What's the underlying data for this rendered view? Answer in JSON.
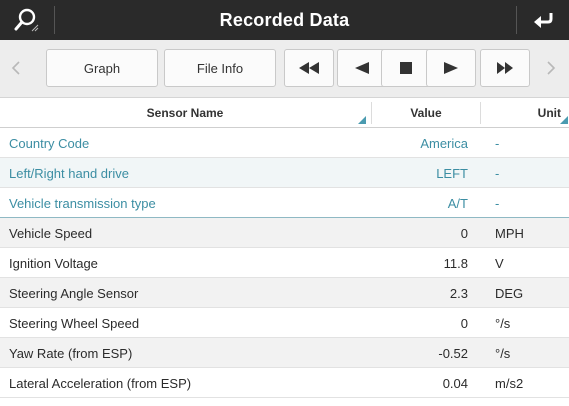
{
  "header": {
    "title": "Recorded Data"
  },
  "toolbar": {
    "graph_label": "Graph",
    "file_info_label": "File Info"
  },
  "table": {
    "columns": {
      "name": "Sensor Name",
      "value": "Value",
      "unit": "Unit"
    },
    "info_rows": [
      {
        "name": "Country Code",
        "value": "America",
        "unit": "-"
      },
      {
        "name": "Left/Right hand drive",
        "value": "LEFT",
        "unit": "-"
      },
      {
        "name": "Vehicle transmission type",
        "value": "A/T",
        "unit": "-"
      }
    ],
    "data_rows": [
      {
        "name": "Vehicle Speed",
        "value": "0",
        "unit": "MPH"
      },
      {
        "name": "Ignition Voltage",
        "value": "11.8",
        "unit": "V"
      },
      {
        "name": "Steering Angle Sensor",
        "value": "2.3",
        "unit": "DEG"
      },
      {
        "name": "Steering Wheel Speed",
        "value": "0",
        "unit": "°/s"
      },
      {
        "name": "Yaw Rate (from ESP)",
        "value": "-0.52",
        "unit": "°/s"
      },
      {
        "name": "Lateral Acceleration (from ESP)",
        "value": "0.04",
        "unit": "m/s2"
      }
    ]
  },
  "colors": {
    "titlebar_bg": "#2a2a2a",
    "info_text": "#3c8ea3",
    "accent": "#3c8ea3"
  },
  "icons": {
    "search": "search-icon",
    "back": "return-arrow-icon",
    "scroll_left": "chevron-left-icon",
    "scroll_right": "chevron-right-icon",
    "rewind": "rewind-icon",
    "step_back": "step-back-icon",
    "stop": "stop-icon",
    "play": "play-icon",
    "fast_forward": "fast-forward-icon"
  }
}
